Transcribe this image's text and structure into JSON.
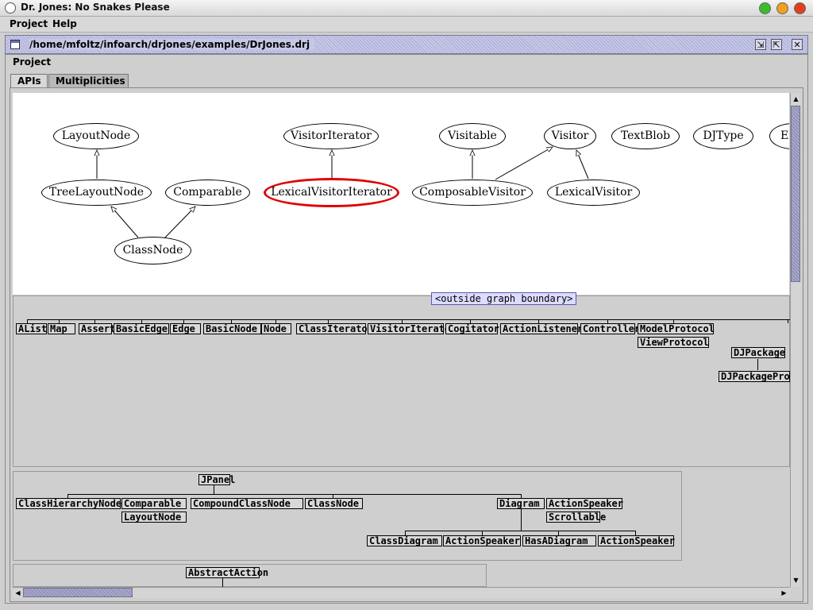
{
  "window": {
    "title": "Dr. Jones: No Snakes Please",
    "controls": [
      "#3cbe2c",
      "#f0a020",
      "#e04020"
    ]
  },
  "menubar": {
    "items": [
      "Project",
      "Help"
    ]
  },
  "frame": {
    "path": "/home/mfoltz/infoarch/drjones/examples/DrJones.drj",
    "menu": "Project",
    "tabs": [
      "APIs",
      "Multiplicities"
    ],
    "active_tab": 1,
    "accent": "#c6c8e6"
  },
  "graph": {
    "selected_color": "#e00000",
    "nodes": [
      "LayoutNode",
      "TreeLayoutNode",
      "Comparable",
      "ClassNode",
      "VisitorIterator",
      "LexicalVisitorIterator",
      "Visitable",
      "ComposableVisitor",
      "Visitor",
      "LexicalVisitor",
      "TextBlob",
      "DJType",
      "Ef"
    ],
    "selected": "LexicalVisitorIterator"
  },
  "outside": {
    "label": "<outside graph boundary>",
    "classes": [
      "AList",
      "Map",
      "Assert",
      "BasicEdge",
      "Edge",
      "BasicNode",
      "Node",
      "ClassIterator",
      "VisitorIterator",
      "Cogitator",
      "ActionListener",
      "Controller",
      "ModelProtocol",
      "ViewProtocol",
      "DJPackage",
      "DJPackageProx"
    ]
  },
  "jpanel": {
    "root": "JPanel",
    "classes": [
      "ClassHierarchyNode",
      "Comparable",
      "LayoutNode",
      "CompoundClassNode",
      "ClassNode",
      "Diagram",
      "ActionSpeaker",
      "Scrollable",
      "ClassDiagram",
      "ActionSpeaker",
      "HasADiagram",
      "ActionSpeaker"
    ]
  },
  "abstract": {
    "root": "AbstractAction"
  }
}
